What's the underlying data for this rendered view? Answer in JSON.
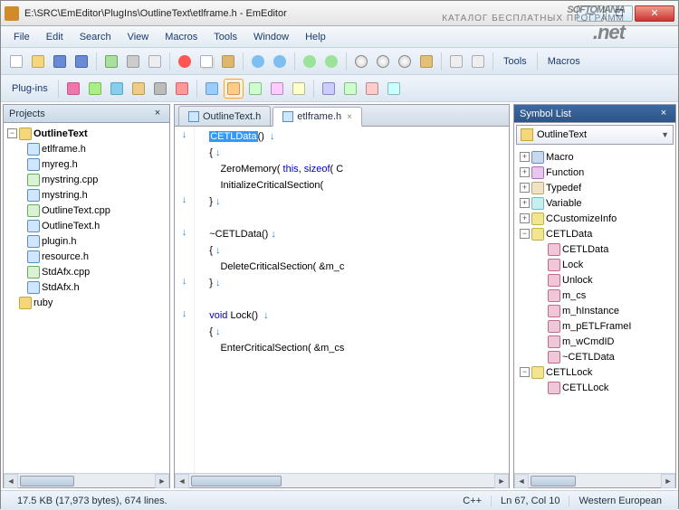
{
  "window": {
    "title": "E:\\SRC\\EmEditor\\PlugIns\\OutlineText\\etlframe.h - EmEditor"
  },
  "menu": [
    "File",
    "Edit",
    "Search",
    "View",
    "Macros",
    "Tools",
    "Window",
    "Help"
  ],
  "toolbar_groups": {
    "right_labels": [
      "Tools",
      "Macros"
    ],
    "plugins_label": "Plug-ins"
  },
  "projects": {
    "title": "Projects",
    "root": "OutlineText",
    "files": [
      {
        "name": "etlframe.h",
        "type": "h"
      },
      {
        "name": "myreg.h",
        "type": "h"
      },
      {
        "name": "mystring.cpp",
        "type": "cpp"
      },
      {
        "name": "mystring.h",
        "type": "h"
      },
      {
        "name": "OutlineText.cpp",
        "type": "cpp"
      },
      {
        "name": "OutlineText.h",
        "type": "h"
      },
      {
        "name": "plugin.h",
        "type": "h"
      },
      {
        "name": "resource.h",
        "type": "h"
      },
      {
        "name": "StdAfx.cpp",
        "type": "cpp"
      },
      {
        "name": "StdAfx.h",
        "type": "h"
      }
    ],
    "other_root": "ruby"
  },
  "tabs": [
    {
      "label": "OutlineText.h",
      "active": false
    },
    {
      "label": "etlframe.h",
      "active": true
    }
  ],
  "code": {
    "selected": "CETLData",
    "lines": [
      {
        "g": "↓",
        "t": "CETLData() ↓",
        "sel": "CETLData",
        "rest": "() ",
        "arr": true
      },
      {
        "g": "",
        "t": "{ ↓"
      },
      {
        "g": "",
        "t": "    ZeroMemory( this, sizeof( C"
      },
      {
        "g": "",
        "t": "    InitializeCriticalSection("
      },
      {
        "g": "↓",
        "t": "} ↓"
      },
      {
        "g": "",
        "t": ""
      },
      {
        "g": "↓",
        "t": "~CETLData() ↓"
      },
      {
        "g": "",
        "t": "{ ↓"
      },
      {
        "g": "",
        "t": "    DeleteCriticalSection( &m_c"
      },
      {
        "g": "↓",
        "t": "} ↓"
      },
      {
        "g": "",
        "t": ""
      },
      {
        "g": "↓",
        "t": "void Lock() ↓"
      },
      {
        "g": "",
        "t": "{ ↓"
      },
      {
        "g": "",
        "t": "    EnterCriticalSection( &m_cs"
      },
      {
        "g": "",
        "t": ""
      }
    ]
  },
  "symbols": {
    "title": "Symbol List",
    "dropdown": "OutlineText",
    "items": [
      {
        "name": "Macro",
        "type": "macro",
        "exp": "+",
        "depth": 0
      },
      {
        "name": "Function",
        "type": "func",
        "exp": "+",
        "depth": 0
      },
      {
        "name": "Typedef",
        "type": "typedef",
        "exp": "+",
        "depth": 0
      },
      {
        "name": "Variable",
        "type": "var",
        "exp": "+",
        "depth": 0
      },
      {
        "name": "CCustomizeInfo",
        "type": "class",
        "exp": "+",
        "depth": 0
      },
      {
        "name": "CETLData",
        "type": "class",
        "exp": "-",
        "depth": 0
      },
      {
        "name": "CETLData",
        "type": "mem",
        "exp": "",
        "depth": 1
      },
      {
        "name": "Lock",
        "type": "mem",
        "exp": "",
        "depth": 1
      },
      {
        "name": "Unlock",
        "type": "mem",
        "exp": "",
        "depth": 1
      },
      {
        "name": "m_cs",
        "type": "mem",
        "exp": "",
        "depth": 1
      },
      {
        "name": "m_hInstance",
        "type": "mem",
        "exp": "",
        "depth": 1
      },
      {
        "name": "m_pETLFrameI",
        "type": "mem",
        "exp": "",
        "depth": 1
      },
      {
        "name": "m_wCmdID",
        "type": "mem",
        "exp": "",
        "depth": 1
      },
      {
        "name": "~CETLData",
        "type": "mem",
        "exp": "",
        "depth": 1
      },
      {
        "name": "CETLLock",
        "type": "class",
        "exp": "-",
        "depth": 0
      },
      {
        "name": "CETLLock",
        "type": "mem",
        "exp": "",
        "depth": 1
      }
    ]
  },
  "status": {
    "size": "17.5 KB (17,973 bytes), 674 lines.",
    "lang": "C++",
    "pos": "Ln 67, Col 10",
    "enc": "Western European"
  },
  "watermark": {
    "brand": "SOFTOMANIA",
    "sub": "КАТАЛОГ БЕСПЛАТНЫХ ПРОГРАММ",
    "net": ".net"
  }
}
